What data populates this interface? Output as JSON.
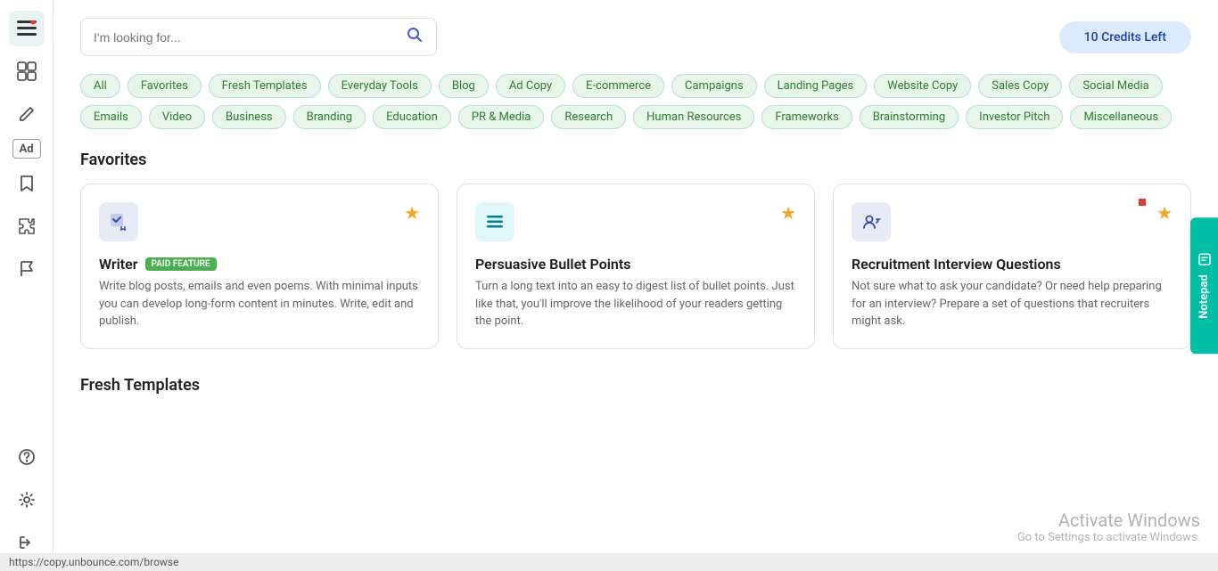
{
  "sidebar": {
    "icons": [
      {
        "name": "layers-icon",
        "symbol": "☰",
        "active": true
      },
      {
        "name": "stack-icon",
        "symbol": "⊞",
        "active": false
      },
      {
        "name": "edit-icon",
        "symbol": "✏",
        "active": false
      },
      {
        "name": "ad-icon",
        "symbol": "Ad",
        "active": false
      },
      {
        "name": "bookmark-icon",
        "symbol": "🔖",
        "active": false
      },
      {
        "name": "puzzle-icon",
        "symbol": "⊕",
        "active": false
      },
      {
        "name": "flag-icon",
        "symbol": "⚑",
        "active": false
      },
      {
        "name": "help-icon",
        "symbol": "?",
        "active": false
      },
      {
        "name": "settings-icon",
        "symbol": "⚙",
        "active": false
      },
      {
        "name": "exit-icon",
        "symbol": "→",
        "active": false
      }
    ]
  },
  "search": {
    "placeholder": "I'm looking for..."
  },
  "credits": {
    "label": "10 Credits Left"
  },
  "filters": {
    "tags": [
      {
        "label": "All",
        "active": false
      },
      {
        "label": "Favorites",
        "active": false
      },
      {
        "label": "Fresh Templates",
        "active": false
      },
      {
        "label": "Everyday Tools",
        "active": false
      },
      {
        "label": "Blog",
        "active": false
      },
      {
        "label": "Ad Copy",
        "active": false
      },
      {
        "label": "E-commerce",
        "active": false
      },
      {
        "label": "Campaigns",
        "active": false
      },
      {
        "label": "Landing Pages",
        "active": false
      },
      {
        "label": "Website Copy",
        "active": false
      },
      {
        "label": "Sales Copy",
        "active": false
      },
      {
        "label": "Social Media",
        "active": false
      },
      {
        "label": "Emails",
        "active": false
      },
      {
        "label": "Video",
        "active": false
      },
      {
        "label": "Business",
        "active": false
      },
      {
        "label": "Branding",
        "active": false
      },
      {
        "label": "Education",
        "active": false
      },
      {
        "label": "PR & Media",
        "active": false
      },
      {
        "label": "Research",
        "active": false
      },
      {
        "label": "Human Resources",
        "active": false
      },
      {
        "label": "Frameworks",
        "active": false
      },
      {
        "label": "Brainstorming",
        "active": false
      },
      {
        "label": "Investor Pitch",
        "active": false
      },
      {
        "label": "Miscellaneous",
        "active": false
      }
    ]
  },
  "favorites": {
    "section_title": "Favorites",
    "cards": [
      {
        "id": "writer",
        "title": "Writer",
        "paid": true,
        "paid_label": "PAID FEATURE",
        "desc": "Write blog posts, emails and even poems. With minimal inputs you can develop long-form content in minutes. Write, edit and publish.",
        "starred": true,
        "icon": "✏",
        "icon_type": "blue"
      },
      {
        "id": "persuasive-bullet-points",
        "title": "Persuasive Bullet Points",
        "paid": false,
        "desc": "Turn a long text into an easy to digest list of bullet points. Just like that, you'll improve the likelihood of your readers getting the point.",
        "starred": true,
        "icon": "≡",
        "icon_type": "green"
      },
      {
        "id": "recruitment-interview-questions",
        "title": "Recruitment Interview Questions",
        "paid": false,
        "desc": "Not sure what to ask your candidate? Or need help preparing for an interview? Prepare a set of questions that recruiters might ask.",
        "starred": true,
        "icon": "👤",
        "icon_type": "blue"
      }
    ]
  },
  "fresh_templates": {
    "section_title": "Fresh Templates"
  },
  "notepad": {
    "label": "Notepad"
  },
  "status_bar": {
    "url": "https://copy.unbounce.com/browse"
  },
  "activate_windows": {
    "title": "Activate Windows",
    "subtitle": "Go to Settings to activate Windows."
  }
}
